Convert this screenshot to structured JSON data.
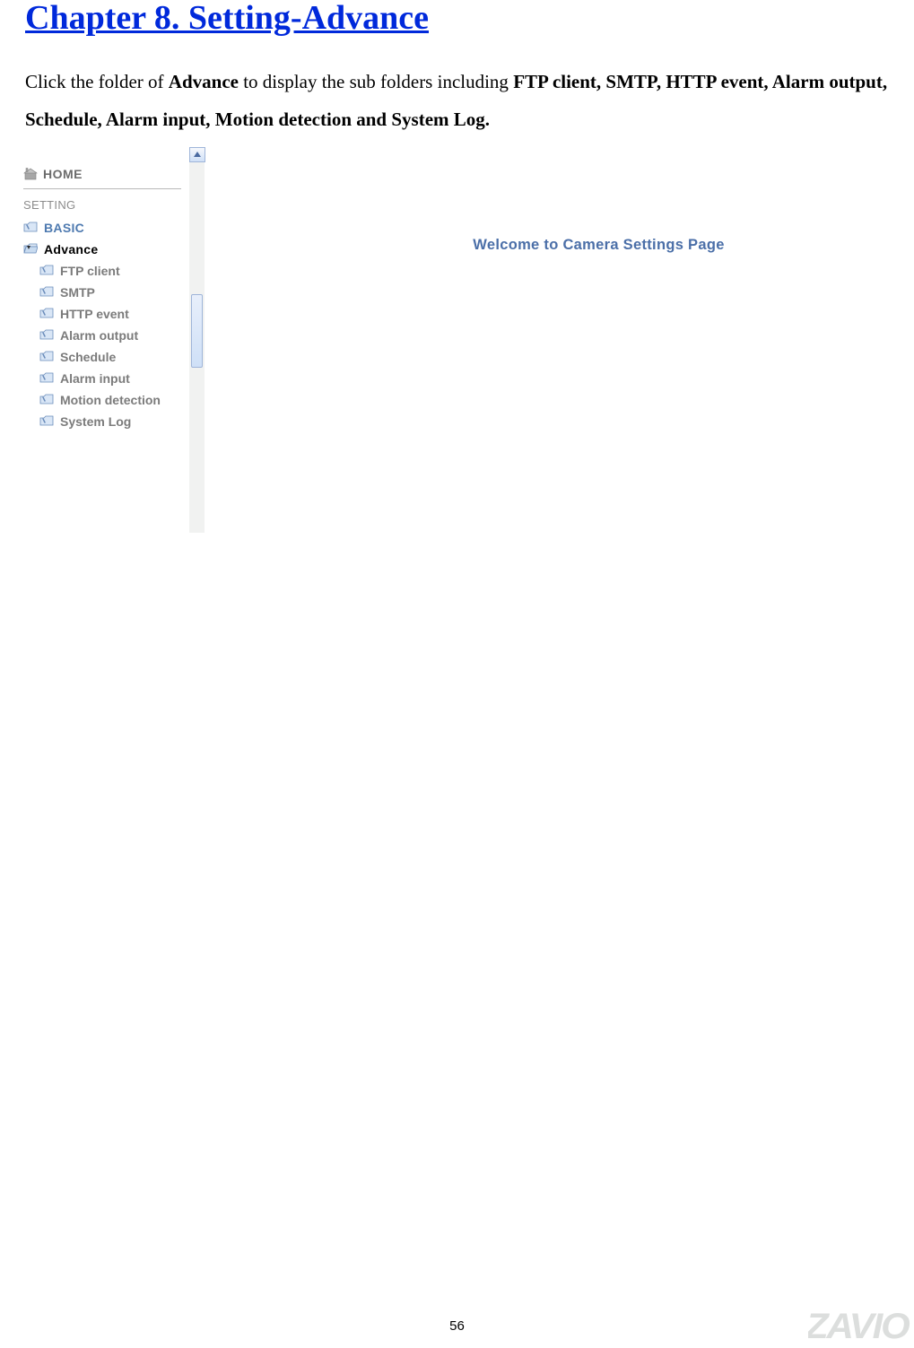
{
  "chapter_title": "Chapter 8. Setting-Advance",
  "intro": {
    "prefix": "Click the folder of ",
    "bold1": "Advance",
    "mid": " to display the sub folders including ",
    "bold2": "FTP client, SMTP, HTTP event, Alarm output, Schedule, Alarm input, Motion detection and System Log."
  },
  "sidebar": {
    "home": "HOME",
    "setting_label": "SETTING",
    "basic": "BASIC",
    "advance": "Advance",
    "subs": [
      "FTP client",
      "SMTP",
      "HTTP event",
      "Alarm output",
      "Schedule",
      "Alarm input",
      "Motion detection",
      "System Log"
    ]
  },
  "content": {
    "welcome": "Welcome to Camera Settings Page"
  },
  "page_number": "56",
  "brand": "ZAVIO"
}
